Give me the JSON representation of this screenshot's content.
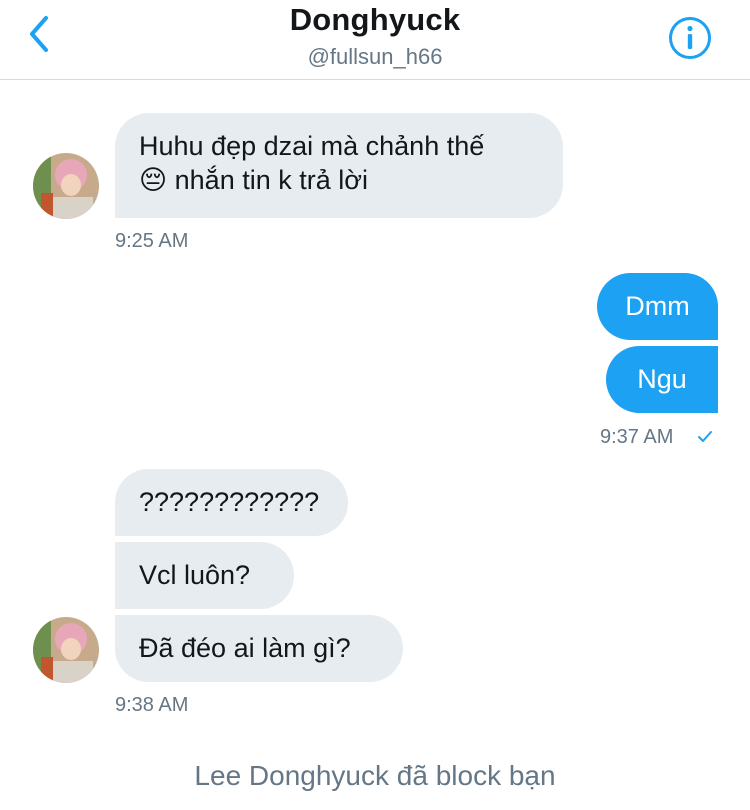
{
  "header": {
    "title": "Donghyuck",
    "handle": "@fullsun_h66",
    "back_icon": "chevron-left-icon",
    "info_icon": "info-icon",
    "accent_color": "#1da1f2"
  },
  "conversation": {
    "group1": {
      "messages": [
        "Huhu đẹp dzai mà chảnh thế",
        "😔 nhắn tin k trả lời"
      ],
      "time": "9:25 AM"
    },
    "group2": {
      "messages": [
        "Dmm",
        "Ngu"
      ],
      "time": "9:37 AM",
      "status_icon": "checkmark-icon"
    },
    "group3": {
      "messages": [
        "????????????",
        "Vcl luôn?",
        "Đã đéo ai làm gì?"
      ],
      "time": "9:38 AM"
    },
    "notice": "Lee Donghyuck đã block bạn"
  },
  "colors": {
    "incoming_bubble": "#e6ecf0",
    "outgoing_bubble": "#1da1f2",
    "secondary_text": "#657786"
  }
}
